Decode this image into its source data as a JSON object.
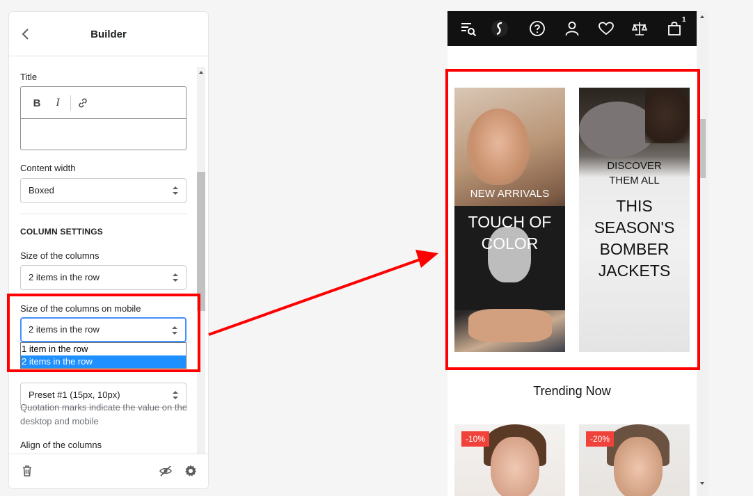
{
  "panel": {
    "title": "Builder",
    "fields": {
      "title_label": "Title",
      "content_width_label": "Content width",
      "content_width_value": "Boxed",
      "section_heading": "COLUMN SETTINGS",
      "columns_size_label": "Size of the columns",
      "columns_size_value": "2 items in the row",
      "columns_mobile_label": "Size of the columns on mobile",
      "columns_mobile_value": "2 items in the row",
      "columns_mobile_options": [
        "1 item in the row",
        "2 items in the row"
      ],
      "preset_value": "Preset #1 (15px, 10px)",
      "help_text": "Quotation marks indicate the value on the desktop and mobile",
      "align_label": "Align of the columns"
    },
    "rte_buttons": {
      "bold": "B",
      "italic": "I"
    }
  },
  "preview": {
    "cart_count": "1",
    "banners": [
      {
        "subtitle": "NEW ARRIVALS",
        "title_line1": "TOUCH OF",
        "title_line2": "COLOR"
      },
      {
        "subtitle_line1": "DISCOVER",
        "subtitle_line2": "THEM ALL",
        "title_line1": "THIS",
        "title_line2": "SEASON'S",
        "title_line3": "BOMBER",
        "title_line4": "JACKETS"
      }
    ],
    "section_title": "Trending Now",
    "products": [
      {
        "badge": "-10%"
      },
      {
        "badge": "-20%"
      }
    ]
  },
  "colors": {
    "highlight": "#ff0000",
    "badge": "#f0423a",
    "topbar": "#111111",
    "selected_option": "#1e90ff"
  }
}
